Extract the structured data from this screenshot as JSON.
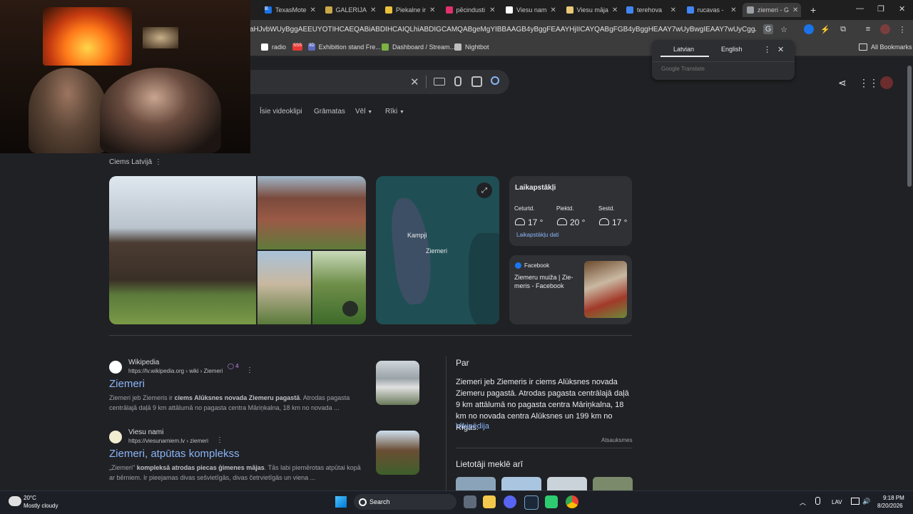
{
  "tabs": [
    {
      "label": "TexasMote",
      "fav": "#1a73e8",
      "favText": "B."
    },
    {
      "label": "GALERIJA",
      "fav": "#c9a84a"
    },
    {
      "label": "Piekalne ir",
      "fav": "#e8c23a"
    },
    {
      "label": "pēcindusti",
      "fav": "#e1306c"
    },
    {
      "label": "Viesu nam",
      "fav": "#ffffff"
    },
    {
      "label": "Viesu māja",
      "fav": "#e8c87a"
    },
    {
      "label": "terehova",
      "fav": "#4285f4"
    },
    {
      "label": "rucavas -",
      "fav": "#4285f4"
    },
    {
      "label": "ziemeri - G",
      "fav": "#9aa0a6"
    }
  ],
  "url": "aHJvbWUyBggAEEUYOTIHCAEQABiABDIHCAIQLhiABDIGCAMQABgeMgYIBBAAGB4yBggFEAAYHjIICAYQABgFGB4yBggHEAAY7wUyBwgIEAAY7wUyCggJEAAYgAQYogTSAQg...",
  "bookmarks": [
    {
      "label": "radio",
      "color": "#ffffff"
    },
    {
      "label": "",
      "color": "#e53935",
      "text": "SSS"
    },
    {
      "label": "Exhibition stand Fre...",
      "color": "#5c6bc0",
      "text": "3D"
    },
    {
      "label": "Dashboard / Stream...",
      "color": "#7cb342"
    },
    {
      "label": "Nightbot",
      "color": "#bdbdbd"
    }
  ],
  "all_bookmarks": "All Bookmarks",
  "translate": {
    "lang1": "Latvian",
    "lang2": "English",
    "brand": "Google Translate"
  },
  "nav": {
    "videos": "Īsie videoklipi",
    "books": "Grāmatas",
    "more": "Vēl",
    "tools": "Rīki"
  },
  "kp": {
    "subtitle": "Ciems Latvijā"
  },
  "map": {
    "label1": "Kampji",
    "label2": "Ziemeri"
  },
  "weather": {
    "title": "Laikapstākļi",
    "days": [
      {
        "day": "Ceturtd.",
        "temp": "17 °",
        "icon": "rain-cloud-icon"
      },
      {
        "day": "Piektd.",
        "temp": "20 °",
        "icon": "sun-cloud-icon"
      },
      {
        "day": "Sestd.",
        "temp": "17 °",
        "icon": "rain-cloud-icon"
      }
    ],
    "link": "Laikapstākļu dati"
  },
  "facebook": {
    "source": "Facebook",
    "title": "Ziemeru muiža | Zie-meris - Facebook"
  },
  "results": [
    {
      "site": "Wikipedia",
      "url": "https://lv.wikipedia.org › wiki › Ziemeri",
      "badge": "4",
      "title": "Ziemeri",
      "snippet_pre": "Ziemeri jeb Ziemeris ir ",
      "snippet_bold": "ciems Alūksnes novada Ziemeru pagastā",
      "snippet_post": ". Atrodas pagasta centrālajā daļā 9 km attālumā no pagasta centra Māriņkalna, 18 km no novada ..."
    },
    {
      "site": "Viesu nami",
      "url": "https://viesunamiem.lv › ziemeri",
      "title": "Ziemeri, atpūtas komplekss",
      "snippet_pre": "„Ziemeri\" ",
      "snippet_bold": "kompleksā atrodas piecas ģimenes mājas",
      "snippet_post": ". Tās labi piemērotas atpūtai kopā ar bērniem. Ir pieejamas divas sešvietīgās, divas četrvietīgās un viena ..."
    }
  ],
  "about": {
    "heading": "Par",
    "text": "Ziemeri jeb Ziemeris ir ciems Alūksnes novada Ziemeru pagastā. Atrodas pagasta centrālajā daļā 9 km attālumā no pagasta centra Māriņkalna, 18 km no novada centra Alūksnes un 199 km no Rīgas.",
    "link": "Vikipēdija",
    "feedback": "Atsauksmes",
    "people_also": "Lietotāji meklē arī"
  },
  "taskbar": {
    "temp": "20°C",
    "weather": "Mostly cloudy",
    "search": "Search",
    "lang": "LAV",
    "time": "9:18 PM",
    "date": "8/20/2026"
  }
}
